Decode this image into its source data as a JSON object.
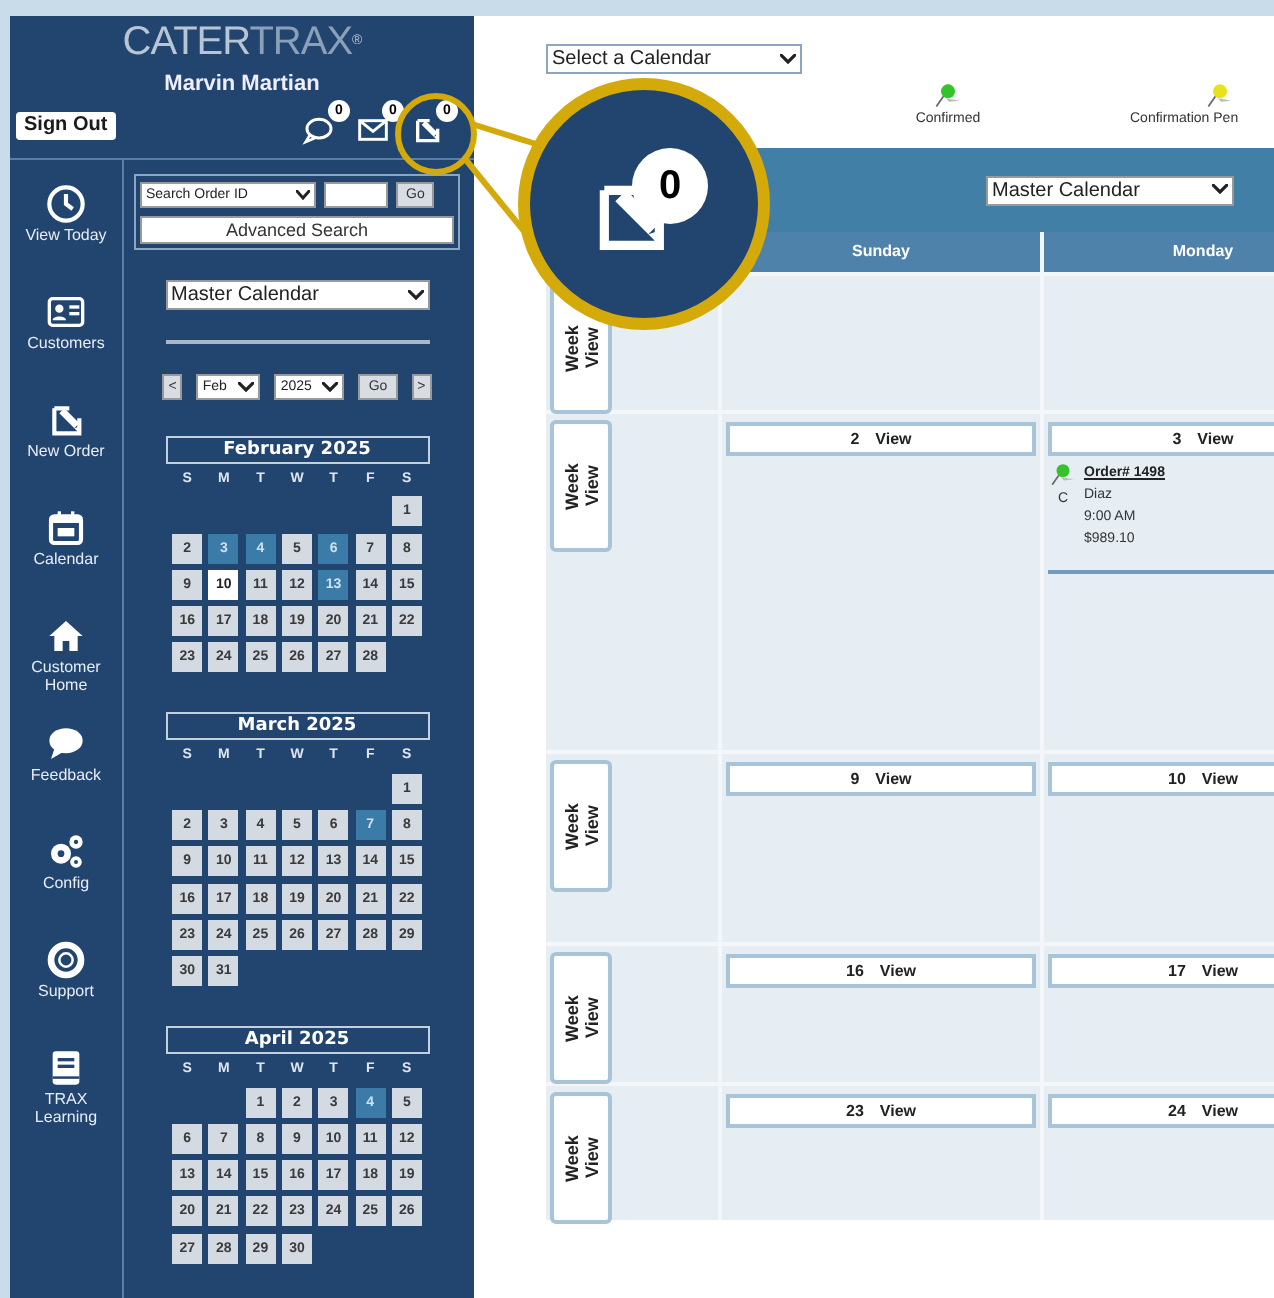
{
  "sidebar": {
    "logo": {
      "first": "CATER",
      "second": "TRAX",
      "mark": "®"
    },
    "user_name": "Marvin Martian",
    "sign_out": "Sign Out",
    "notifications": [
      {
        "kind": "chat",
        "count": "0"
      },
      {
        "kind": "mail",
        "count": "0"
      },
      {
        "kind": "order",
        "count": "0"
      }
    ],
    "nav": [
      {
        "kind": "clock",
        "label": "View Today"
      },
      {
        "kind": "card",
        "label": "Customers"
      },
      {
        "kind": "order",
        "label": "New Order"
      },
      {
        "kind": "calendar",
        "label": "Calendar"
      },
      {
        "kind": "house",
        "label": "Customer Home"
      },
      {
        "kind": "chat",
        "label": "Feedback"
      },
      {
        "kind": "gears",
        "label": "Config"
      },
      {
        "kind": "lifebuoy",
        "label": "Support"
      },
      {
        "kind": "book",
        "label": "TRAX Learning"
      }
    ],
    "search": {
      "type_select": "Search Order ID",
      "go": "Go",
      "advanced": "Advanced Search"
    },
    "calendar_select": "Master Calendar",
    "month_nav": {
      "prev": "<",
      "month": "Feb",
      "year": "2025",
      "go": "Go",
      "next": ">"
    },
    "mini_calendars": [
      {
        "title": "February 2025",
        "weekdays": [
          "S",
          "M",
          "T",
          "W",
          "T",
          "F",
          "S"
        ],
        "weeks": [
          {
            "align_end": true,
            "days": [
              {
                "day": "1",
                "marked": false,
                "today": false
              }
            ]
          },
          {
            "days": [
              {
                "day": "2",
                "marked": false,
                "today": false
              },
              {
                "day": "3",
                "marked": true,
                "today": false
              },
              {
                "day": "4",
                "marked": true,
                "today": false
              },
              {
                "day": "5",
                "marked": false,
                "today": false
              },
              {
                "day": "6",
                "marked": true,
                "today": false
              },
              {
                "day": "7",
                "marked": false,
                "today": false
              },
              {
                "day": "8",
                "marked": false,
                "today": false
              }
            ]
          },
          {
            "days": [
              {
                "day": "9",
                "marked": false,
                "today": false
              },
              {
                "day": "10",
                "marked": false,
                "today": true
              },
              {
                "day": "11",
                "marked": false,
                "today": false
              },
              {
                "day": "12",
                "marked": false,
                "today": false
              },
              {
                "day": "13",
                "marked": true,
                "today": false
              },
              {
                "day": "14",
                "marked": false,
                "today": false
              },
              {
                "day": "15",
                "marked": false,
                "today": false
              }
            ]
          },
          {
            "days": [
              {
                "day": "16",
                "marked": false,
                "today": false
              },
              {
                "day": "17",
                "marked": false,
                "today": false
              },
              {
                "day": "18",
                "marked": false,
                "today": false
              },
              {
                "day": "19",
                "marked": false,
                "today": false
              },
              {
                "day": "20",
                "marked": false,
                "today": false
              },
              {
                "day": "21",
                "marked": false,
                "today": false
              },
              {
                "day": "22",
                "marked": false,
                "today": false
              }
            ]
          },
          {
            "days": [
              {
                "day": "23",
                "marked": false,
                "today": false
              },
              {
                "day": "24",
                "marked": false,
                "today": false
              },
              {
                "day": "25",
                "marked": false,
                "today": false
              },
              {
                "day": "26",
                "marked": false,
                "today": false
              },
              {
                "day": "27",
                "marked": false,
                "today": false
              },
              {
                "day": "28",
                "marked": false,
                "today": false
              }
            ]
          }
        ]
      },
      {
        "title": "March 2025",
        "weekdays": [
          "S",
          "M",
          "T",
          "W",
          "T",
          "F",
          "S"
        ],
        "weeks": [
          {
            "align_end": true,
            "days": [
              {
                "day": "1",
                "marked": false,
                "today": false
              }
            ]
          },
          {
            "days": [
              {
                "day": "2",
                "marked": false,
                "today": false
              },
              {
                "day": "3",
                "marked": false,
                "today": false
              },
              {
                "day": "4",
                "marked": false,
                "today": false
              },
              {
                "day": "5",
                "marked": false,
                "today": false
              },
              {
                "day": "6",
                "marked": false,
                "today": false
              },
              {
                "day": "7",
                "marked": true,
                "today": false
              },
              {
                "day": "8",
                "marked": false,
                "today": false
              }
            ]
          },
          {
            "days": [
              {
                "day": "9",
                "marked": false,
                "today": false
              },
              {
                "day": "10",
                "marked": false,
                "today": false
              },
              {
                "day": "11",
                "marked": false,
                "today": false
              },
              {
                "day": "12",
                "marked": false,
                "today": false
              },
              {
                "day": "13",
                "marked": false,
                "today": false
              },
              {
                "day": "14",
                "marked": false,
                "today": false
              },
              {
                "day": "15",
                "marked": false,
                "today": false
              }
            ]
          },
          {
            "days": [
              {
                "day": "16",
                "marked": false,
                "today": false
              },
              {
                "day": "17",
                "marked": false,
                "today": false
              },
              {
                "day": "18",
                "marked": false,
                "today": false
              },
              {
                "day": "19",
                "marked": false,
                "today": false
              },
              {
                "day": "20",
                "marked": false,
                "today": false
              },
              {
                "day": "21",
                "marked": false,
                "today": false
              },
              {
                "day": "22",
                "marked": false,
                "today": false
              }
            ]
          },
          {
            "days": [
              {
                "day": "23",
                "marked": false,
                "today": false
              },
              {
                "day": "24",
                "marked": false,
                "today": false
              },
              {
                "day": "25",
                "marked": false,
                "today": false
              },
              {
                "day": "26",
                "marked": false,
                "today": false
              },
              {
                "day": "27",
                "marked": false,
                "today": false
              },
              {
                "day": "28",
                "marked": false,
                "today": false
              },
              {
                "day": "29",
                "marked": false,
                "today": false
              }
            ]
          },
          {
            "days": [
              {
                "day": "30",
                "marked": false,
                "today": false
              },
              {
                "day": "31",
                "marked": false,
                "today": false
              }
            ]
          }
        ]
      },
      {
        "title": "April 2025",
        "weekdays": [
          "S",
          "M",
          "T",
          "W",
          "T",
          "F",
          "S"
        ],
        "weeks": [
          {
            "align_end": true,
            "days": [
              {
                "day": "1",
                "marked": false,
                "today": false
              },
              {
                "day": "2",
                "marked": false,
                "today": false
              },
              {
                "day": "3",
                "marked": false,
                "today": false
              },
              {
                "day": "4",
                "marked": true,
                "today": false
              },
              {
                "day": "5",
                "marked": false,
                "today": false
              }
            ]
          },
          {
            "days": [
              {
                "day": "6",
                "marked": false,
                "today": false
              },
              {
                "day": "7",
                "marked": false,
                "today": false
              },
              {
                "day": "8",
                "marked": false,
                "today": false
              },
              {
                "day": "9",
                "marked": false,
                "today": false
              },
              {
                "day": "10",
                "marked": false,
                "today": false
              },
              {
                "day": "11",
                "marked": false,
                "today": false
              },
              {
                "day": "12",
                "marked": false,
                "today": false
              }
            ]
          },
          {
            "days": [
              {
                "day": "13",
                "marked": false,
                "today": false
              },
              {
                "day": "14",
                "marked": false,
                "today": false
              },
              {
                "day": "15",
                "marked": false,
                "today": false
              },
              {
                "day": "16",
                "marked": false,
                "today": false
              },
              {
                "day": "17",
                "marked": false,
                "today": false
              },
              {
                "day": "18",
                "marked": false,
                "today": false
              },
              {
                "day": "19",
                "marked": false,
                "today": false
              }
            ]
          },
          {
            "days": [
              {
                "day": "20",
                "marked": false,
                "today": false
              },
              {
                "day": "21",
                "marked": false,
                "today": false
              },
              {
                "day": "22",
                "marked": false,
                "today": false
              },
              {
                "day": "23",
                "marked": false,
                "today": false
              },
              {
                "day": "24",
                "marked": false,
                "today": false
              },
              {
                "day": "25",
                "marked": false,
                "today": false
              },
              {
                "day": "26",
                "marked": false,
                "today": false
              }
            ]
          },
          {
            "days": [
              {
                "day": "27",
                "marked": false,
                "today": false
              },
              {
                "day": "28",
                "marked": false,
                "today": false
              },
              {
                "day": "29",
                "marked": false,
                "today": false
              },
              {
                "day": "30",
                "marked": false,
                "today": false
              }
            ]
          }
        ]
      }
    ]
  },
  "main": {
    "calendar_select": "Select a Calendar",
    "legend": [
      {
        "label": "Confirmed",
        "color": "#36c22a"
      },
      {
        "label": "Confirmation Pen",
        "color": "#e6e21c"
      }
    ],
    "header_select": "Master Calendar",
    "columns": [
      "Sunday",
      "Monday"
    ],
    "weeks": [
      {
        "week_button": "Week View"
      },
      {
        "week_button": "Week View",
        "days": [
          {
            "day": "2",
            "link": "View"
          },
          {
            "day": "3",
            "link": "View",
            "orders": [
              {
                "color": "#36c22a",
                "code": "C",
                "number": "Order# 1498",
                "name": "Diaz",
                "time": "9:00 AM",
                "total": "$989.10"
              }
            ]
          }
        ]
      },
      {
        "week_button": "Week View",
        "days": [
          {
            "day": "9",
            "link": "View"
          },
          {
            "day": "10",
            "link": "View"
          }
        ]
      },
      {
        "week_button": "Week View",
        "days": [
          {
            "day": "16",
            "link": "View"
          },
          {
            "day": "17",
            "link": "View"
          }
        ]
      },
      {
        "week_button": "Week View",
        "days": [
          {
            "day": "23",
            "link": "View"
          },
          {
            "day": "24",
            "link": "View"
          }
        ]
      }
    ]
  },
  "callout": {
    "count": "0"
  }
}
